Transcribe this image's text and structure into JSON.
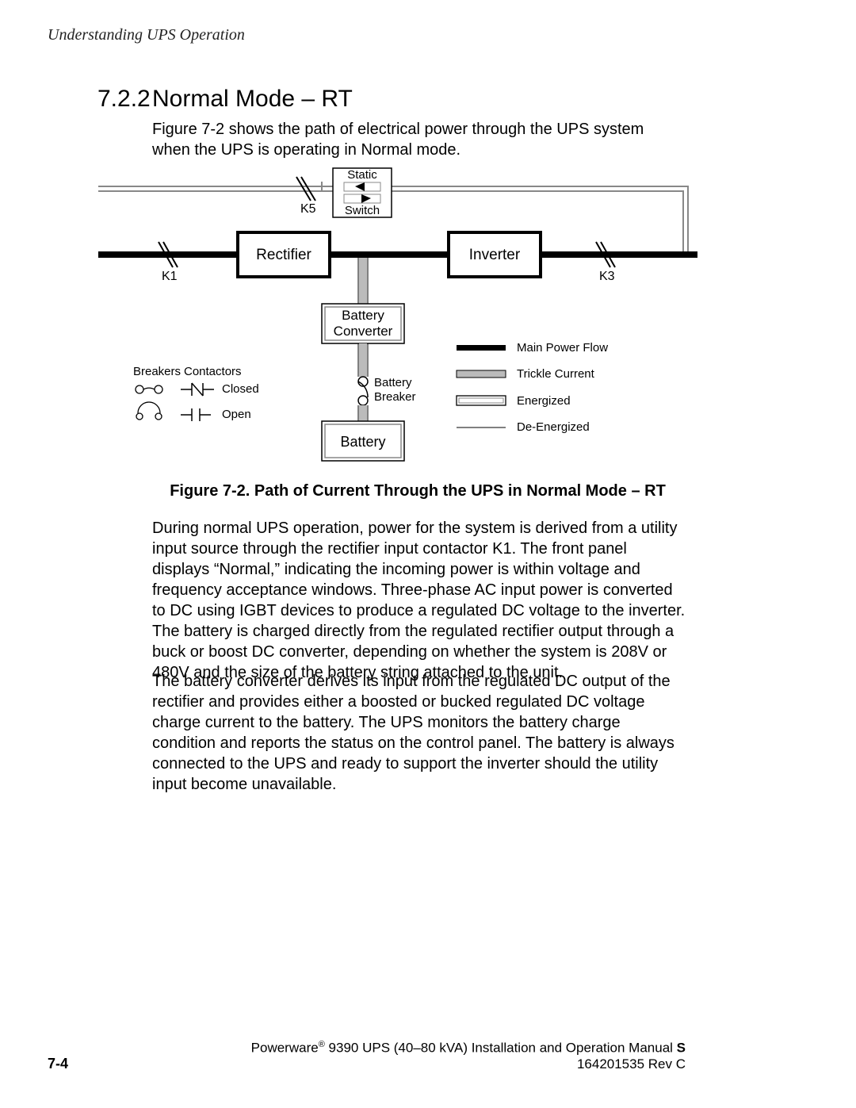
{
  "header": {
    "running_title": "Understanding UPS Operation"
  },
  "section": {
    "number": "7.2.2",
    "title": "Normal Mode – RT",
    "intro": "Figure 7-2 shows the path of electrical power through the UPS system when the UPS is operating in Normal mode."
  },
  "diagram": {
    "blocks": {
      "static_top": "Static",
      "static_bottom": "Switch",
      "rectifier": "Rectifier",
      "inverter": "Inverter",
      "battery_converter_l1": "Battery",
      "battery_converter_l2": "Converter",
      "battery_breaker_l1": "Battery",
      "battery_breaker_l2": "Breaker",
      "battery": "Battery"
    },
    "labels": {
      "k5": "K5",
      "k1": "K1",
      "k3": "K3"
    },
    "legend_left": {
      "breakers_heading": "Breakers",
      "contactors_heading": "Contactors",
      "closed": "Closed",
      "open": "Open"
    },
    "legend_right": {
      "main_power": "Main Power Flow",
      "trickle": "Trickle Current",
      "energized": "Energized",
      "deenergized": "De-Energized"
    }
  },
  "figure_caption": "Figure 7-2. Path of Current Through the UPS in Normal Mode – RT",
  "body": {
    "p1": "During normal UPS operation, power for the system is derived from a utility input source through the rectifier input contactor K1. The front panel displays “Normal,” indicating the incoming power is within voltage and frequency acceptance windows. Three-phase AC input power is converted to DC using IGBT devices to produce a regulated DC voltage to the inverter. The battery is charged directly from the regulated rectifier output through a buck or boost DC converter, depending on whether the system is 208V or 480V and the size of the battery string attached to the unit.",
    "p2": "The battery converter derives its input from the regulated DC output of the rectifier and provides either a boosted or bucked regulated DC voltage charge current to the battery. The UPS monitors the battery charge condition and reports the status on the control panel. The battery is always connected to the UPS and ready to support the inverter should the utility input become unavailable."
  },
  "footer": {
    "page_num": "7-4",
    "product": "Powerware",
    "reg": "®",
    "manual_title": " 9390 UPS (40–80 kVA) Installation and Operation Manual",
    "bullet": " S ",
    "doc_id": "164201535 Rev C"
  }
}
